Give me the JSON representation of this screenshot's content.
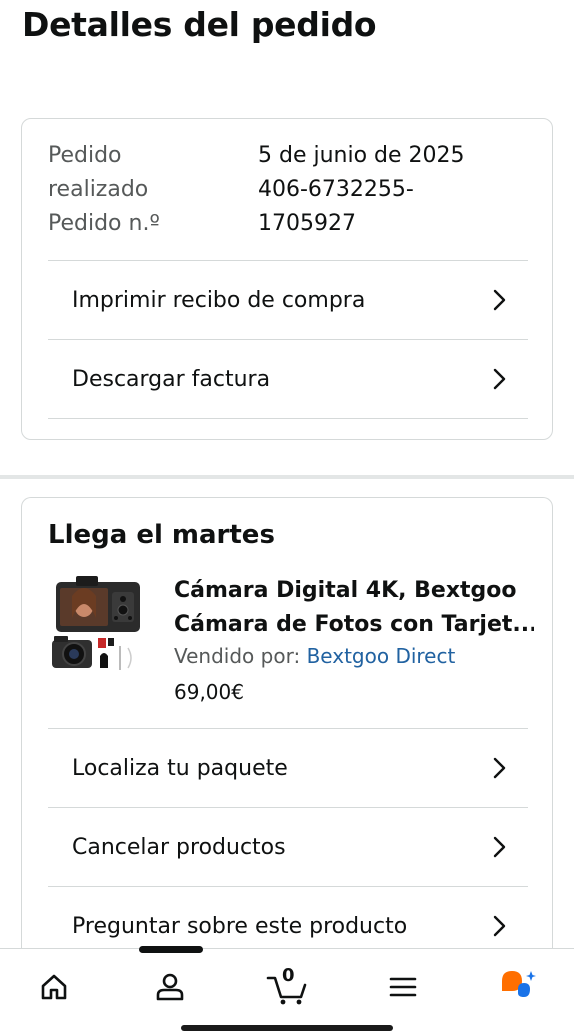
{
  "page": {
    "title": "Detalles del pedido"
  },
  "order_summary": {
    "fields": [
      {
        "label_lines": [
          "Pedido",
          "realizado"
        ],
        "value_lines": [
          "5 de junio de 2025"
        ]
      },
      {
        "label_lines": [
          "Pedido n.º"
        ],
        "value_lines": [
          "406-6732255-",
          "1705927"
        ]
      }
    ],
    "label_1a": "Pedido",
    "label_1b": "realizado",
    "value_1": "5 de junio de 2025",
    "label_2": "Pedido n.º",
    "value_2a": "406-6732255-",
    "value_2b": "1705927",
    "actions": {
      "print_receipt": "Imprimir recibo de compra",
      "download_invoice": "Descargar factura"
    }
  },
  "shipment": {
    "arrival_title": "Llega el martes",
    "product": {
      "title_line1": "Cámara Digital 4K, Bextgoo",
      "title_line2": "Cámara de Fotos con Tarjet...",
      "seller_prefix": "Vendido por: ",
      "seller_name": "Bextgoo Direct",
      "price": "69,00€"
    },
    "actions": {
      "track_package": "Localiza tu paquete",
      "cancel_products": "Cancelar productos",
      "ask_product": "Preguntar sobre este producto"
    }
  },
  "bottom_nav": {
    "items": [
      "home-icon",
      "account-icon",
      "cart-icon",
      "menu-icon",
      "assistant-icon"
    ],
    "cart_count": "0",
    "active_index": 1
  },
  "colors": {
    "text": "#0f1111",
    "secondary_text": "#565959",
    "link": "#2162a1",
    "border": "#d5d9d9",
    "assistant_orange": "#ff6f00",
    "assistant_blue": "#1a73e8"
  }
}
